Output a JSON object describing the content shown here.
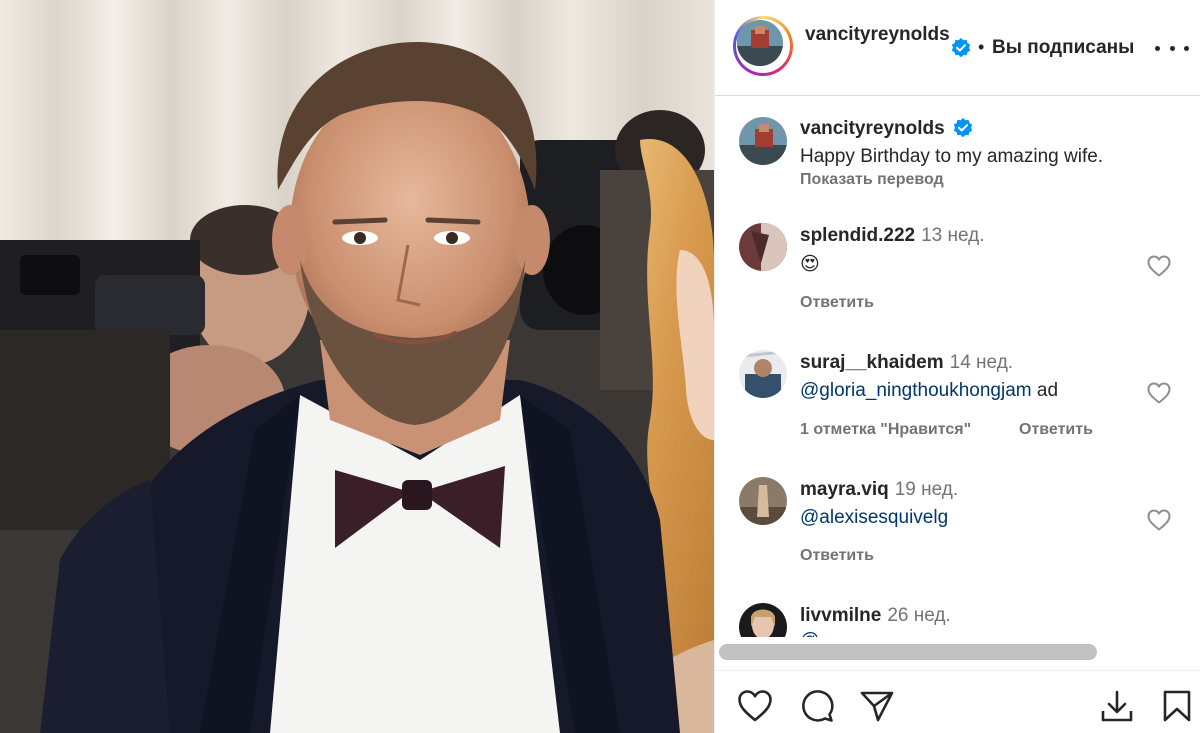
{
  "post": {
    "author": "vancityreynolds",
    "follow_status": "Вы подписаны",
    "separator": "•"
  },
  "caption": {
    "username": "vancityreynolds",
    "text": "Happy Birthday to my amazing wife.",
    "translate_label": "Показать перевод"
  },
  "comments": [
    {
      "username": "splendid.222",
      "time": "13 нед.",
      "text": "😍",
      "mention": "",
      "likes_label": "",
      "reply_label": "Ответить"
    },
    {
      "username": "suraj__khaidem",
      "time": "14 нед.",
      "mention": "@gloria_ningthoukhongjam",
      "text": " ad",
      "likes_label": "1 отметка \"Нравится\"",
      "reply_label": "Ответить"
    },
    {
      "username": "mayra.viq",
      "time": "19 нед.",
      "mention": "@alexisesquivelg",
      "text": "",
      "likes_label": "",
      "reply_label": "Ответить"
    },
    {
      "username": "livvmilne",
      "time": "26 нед.",
      "mention": "@",
      "text": "",
      "likes_label": "",
      "reply_label": ""
    }
  ],
  "icons": {
    "more": "more-horizontal-icon",
    "verified": "verified-badge-icon",
    "like": "heart-icon",
    "comment": "comment-icon",
    "share": "share-icon",
    "download": "download-icon",
    "save": "bookmark-icon"
  },
  "colors": {
    "verified_blue": "#0095f6",
    "mention_blue": "#00376b",
    "muted_text": "#737373",
    "text": "#262626"
  }
}
